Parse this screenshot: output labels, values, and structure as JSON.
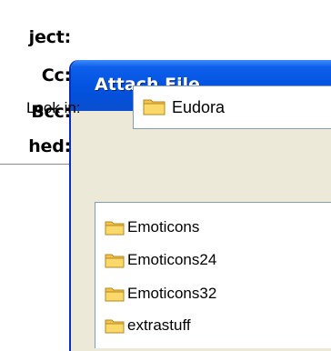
{
  "compose": {
    "labels": {
      "subject": "ject:",
      "cc": "Cc:",
      "bcc": "Bcc:",
      "attached": "hed:"
    }
  },
  "dialog": {
    "title": "Attach File",
    "look_in_label": "Look in:",
    "look_in_value": "Eudora",
    "look_in_icon": "folder-icon",
    "files": [
      {
        "label": "Emoticons",
        "icon": "folder-icon"
      },
      {
        "label": "Emoticons24",
        "icon": "folder-icon"
      },
      {
        "label": "Emoticons32",
        "icon": "folder-icon"
      },
      {
        "label": "extrastuff",
        "icon": "folder-icon"
      }
    ]
  },
  "colors": {
    "titlebar": "#0555e3",
    "dialog_face": "#ece9d8",
    "field_border": "#7f9db9",
    "folder_yellow": "#f5c94a"
  }
}
